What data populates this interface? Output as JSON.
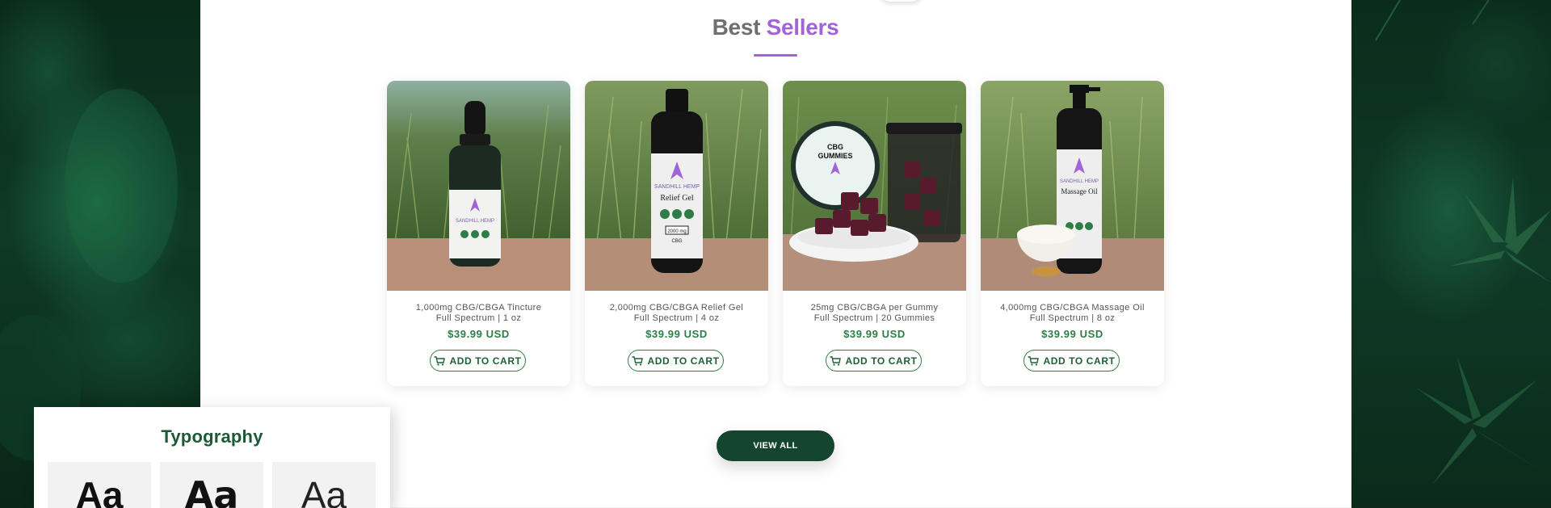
{
  "section": {
    "title_part1": "Best",
    "title_part2": "Sellers"
  },
  "products": [
    {
      "name_line1": "1,000mg CBG/CBGA Tincture",
      "name_line2": "Full Spectrum | 1 oz",
      "price": "$39.99 USD",
      "cart_label": "ADD TO CART"
    },
    {
      "name_line1": "2,000mg CBG/CBGA Relief Gel",
      "name_line2": "Full Spectrum | 4 oz",
      "price": "$39.99 USD",
      "cart_label": "ADD TO CART"
    },
    {
      "name_line1": "25mg CBG/CBGA per Gummy",
      "name_line2": "Full Spectrum | 20 Gummies",
      "price": "$39.99 USD",
      "cart_label": "ADD TO CART"
    },
    {
      "name_line1": "4,000mg CBG/CBGA Massage Oil",
      "name_line2": "Full Spectrum | 8 oz",
      "price": "$39.99 USD",
      "cart_label": "ADD TO CART"
    }
  ],
  "view_all_label": "VIEW ALL",
  "typography_panel": {
    "title": "Typography",
    "samples": [
      "Aa",
      "Aa",
      "Aa"
    ]
  },
  "label_texts": {
    "product1_brand": "SANDHILL HEMP",
    "product2_brand": "SANDHILL HEMP",
    "product2_product": "Relief Gel",
    "product2_amount": "2000 mg",
    "product2_cbg": "CBG",
    "product3_lid_line1": "CBG",
    "product3_lid_line2": "GUMMIES",
    "product4_brand": "SANDHILL HEMP",
    "product4_product": "Massage Oil"
  },
  "colors": {
    "accent_purple": "#a064d8",
    "heading_gray": "#6f6f6f",
    "price_green": "#2e7d46",
    "button_dark_green": "#144530",
    "typography_green": "#1c5a37"
  },
  "icons": {
    "cart": "cart-icon"
  }
}
